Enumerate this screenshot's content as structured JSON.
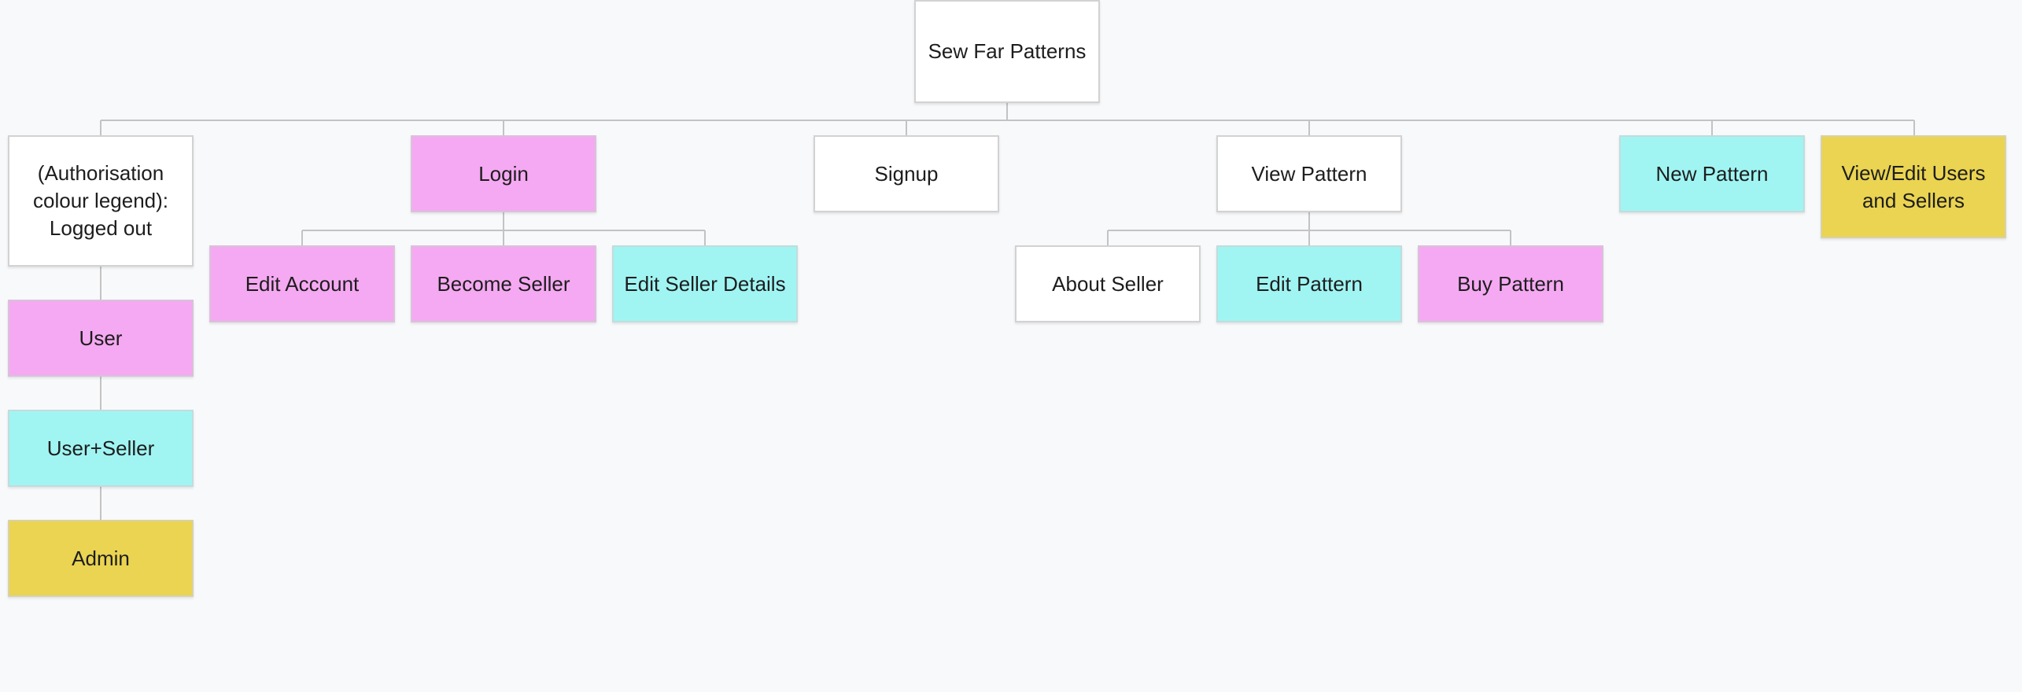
{
  "diagram": {
    "root": "Sew Far Patterns",
    "legend": {
      "logged_out": "(Authorisation colour legend): Logged out",
      "user": "User",
      "user_seller": "User+Seller",
      "admin": "Admin"
    },
    "nodes": {
      "login": "Login",
      "edit_account": "Edit Account",
      "become_seller": "Become Seller",
      "edit_seller_details": "Edit Seller Details",
      "signup": "Signup",
      "view_pattern": "View Pattern",
      "about_seller": "About Seller",
      "edit_pattern": "Edit Pattern",
      "buy_pattern": "Buy Pattern",
      "new_pattern": "New Pattern",
      "view_edit_users": "View/Edit Users and Sellers"
    },
    "colors": {
      "logged_out": "#ffffff",
      "user": "#f5a9f2",
      "user_seller": "#a0f5f3",
      "admin": "#ead451",
      "connector": "#c3c3c3",
      "background": "#f8f9fb"
    }
  }
}
